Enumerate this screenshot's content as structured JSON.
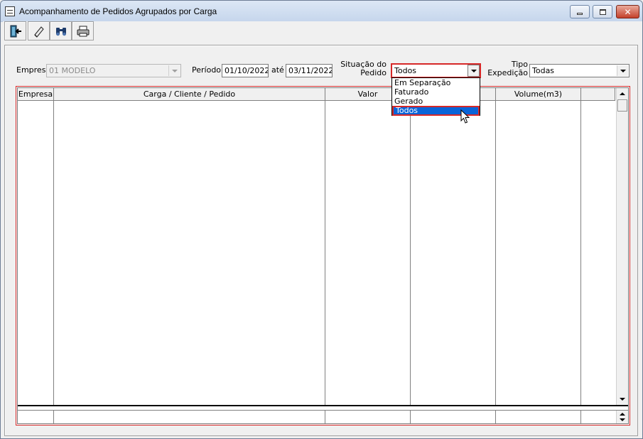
{
  "window": {
    "title": "Acompanhamento de Pedidos Agrupados por Carga"
  },
  "toolbar": {
    "buttons": [
      {
        "name": "exit-button",
        "icon": "exit-door-icon"
      },
      {
        "name": "clear-button",
        "icon": "eraser-icon"
      },
      {
        "name": "search-button",
        "icon": "binoculars-icon"
      },
      {
        "name": "print-button",
        "icon": "printer-icon"
      }
    ]
  },
  "filters": {
    "empresa_label": "Empresa",
    "empresa_value": "01 MODELO",
    "periodo_label": "Período",
    "periodo_from": "01/10/2022",
    "ate_label": "até",
    "periodo_to": "03/11/2022",
    "situacao_label_1": "Situação do",
    "situacao_label_2": "Pedido",
    "situacao_value": "Todos",
    "situacao_options": [
      "Em Separação",
      "Faturado",
      "Gerado",
      "Todos"
    ],
    "situacao_selected": "Todos",
    "tipo_label_1": "Tipo",
    "tipo_label_2": "Expedição",
    "tipo_value": "Todas"
  },
  "grid": {
    "columns": [
      "Empresa",
      "Carga / Cliente / Pedido",
      "Valor",
      "",
      "Volume(m3)",
      ""
    ],
    "rows": []
  },
  "colors": {
    "highlight_border": "#d62828",
    "selection": "#0a64d8"
  }
}
